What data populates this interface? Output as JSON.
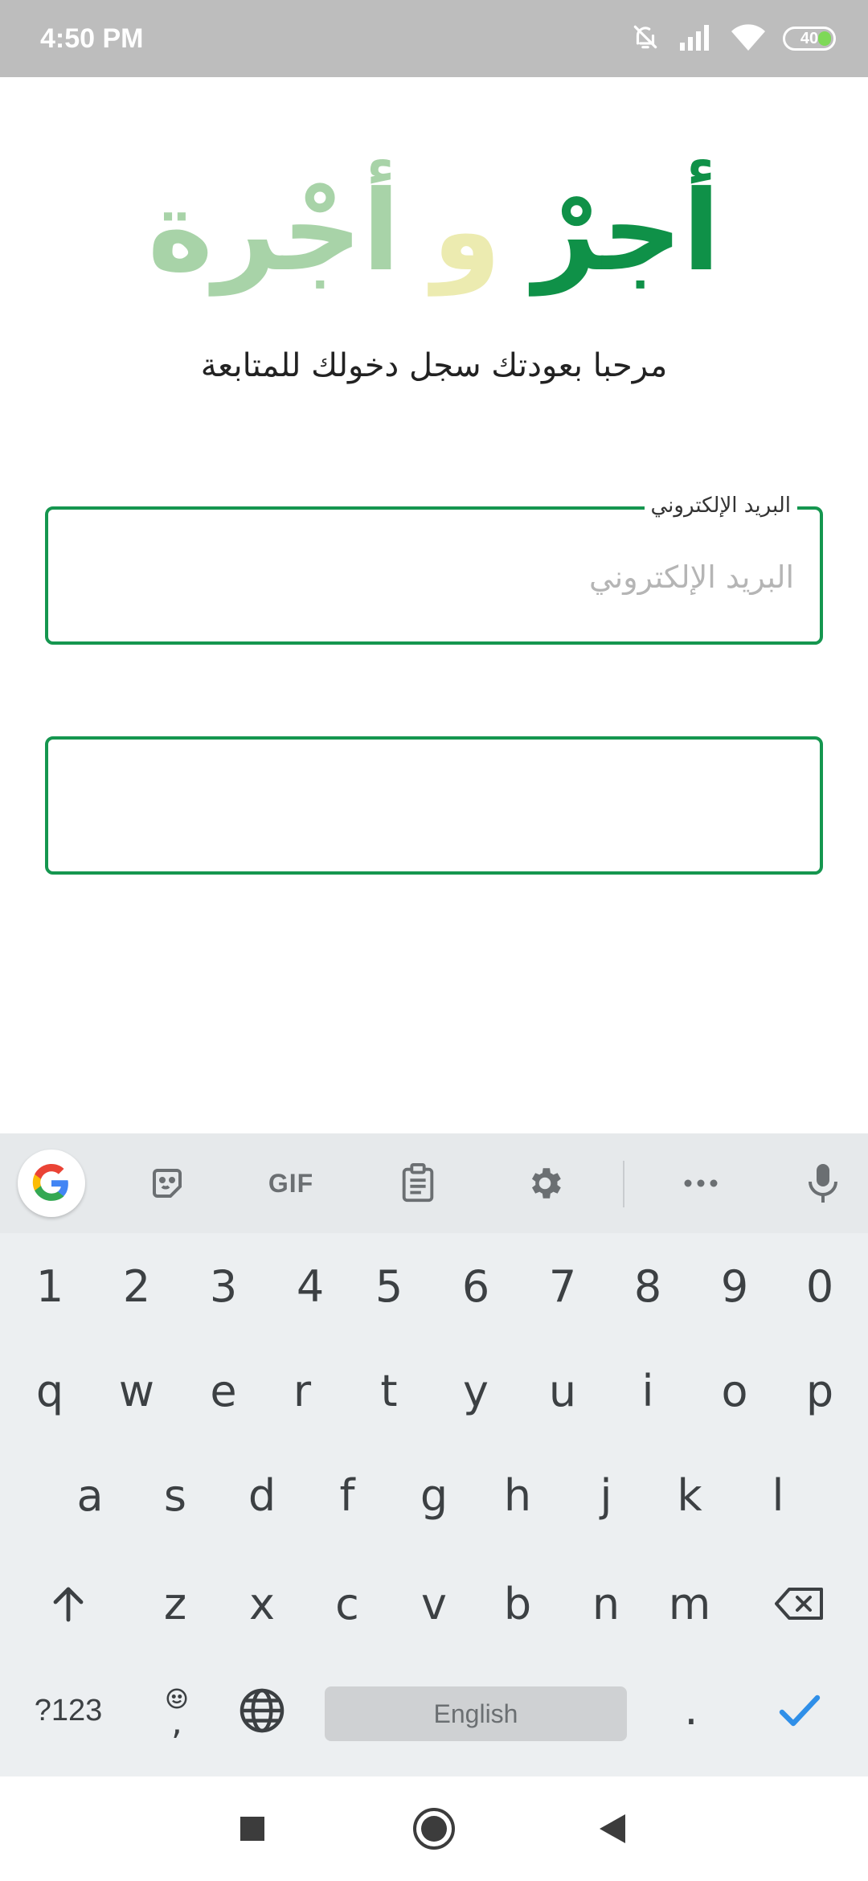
{
  "status_bar": {
    "time": "4:50 PM",
    "battery_level": "40",
    "icons": [
      "mute-bell-icon",
      "signal-icon",
      "wifi-icon",
      "battery-icon"
    ]
  },
  "app": {
    "logo": {
      "word1": "أجرْ",
      "connector": "و",
      "word2": "أجْرة"
    },
    "subtitle": "مرحبا بعودتك سجل دخولك للمتابعة",
    "email_field": {
      "label": "البريد الإلكتروني",
      "placeholder": "البريد الإلكتروني",
      "value": ""
    },
    "password_field": {
      "value": ""
    },
    "colors": {
      "primary": "#0f9148",
      "accent_yellow": "#ecebb0",
      "accent_light_green": "#a8d3a8"
    }
  },
  "keyboard": {
    "toolbar": [
      "google-icon",
      "sticker-icon",
      "GIF",
      "clipboard-icon",
      "settings-icon",
      "more-icon",
      "mic-icon"
    ],
    "gif_label": "GIF",
    "rows": {
      "numbers": [
        "1",
        "2",
        "3",
        "4",
        "5",
        "6",
        "7",
        "8",
        "9",
        "0"
      ],
      "top": [
        "q",
        "w",
        "e",
        "r",
        "t",
        "y",
        "u",
        "i",
        "o",
        "p"
      ],
      "middle": [
        "a",
        "s",
        "d",
        "f",
        "g",
        "h",
        "j",
        "k",
        "l"
      ],
      "bottom": [
        "z",
        "x",
        "c",
        "v",
        "b",
        "n",
        "m"
      ]
    },
    "symbols_key": "?123",
    "comma_key": ",",
    "space_label": "English",
    "period_key": "."
  },
  "nav_bar": {
    "buttons": [
      "recents-button",
      "home-button",
      "back-button"
    ]
  }
}
